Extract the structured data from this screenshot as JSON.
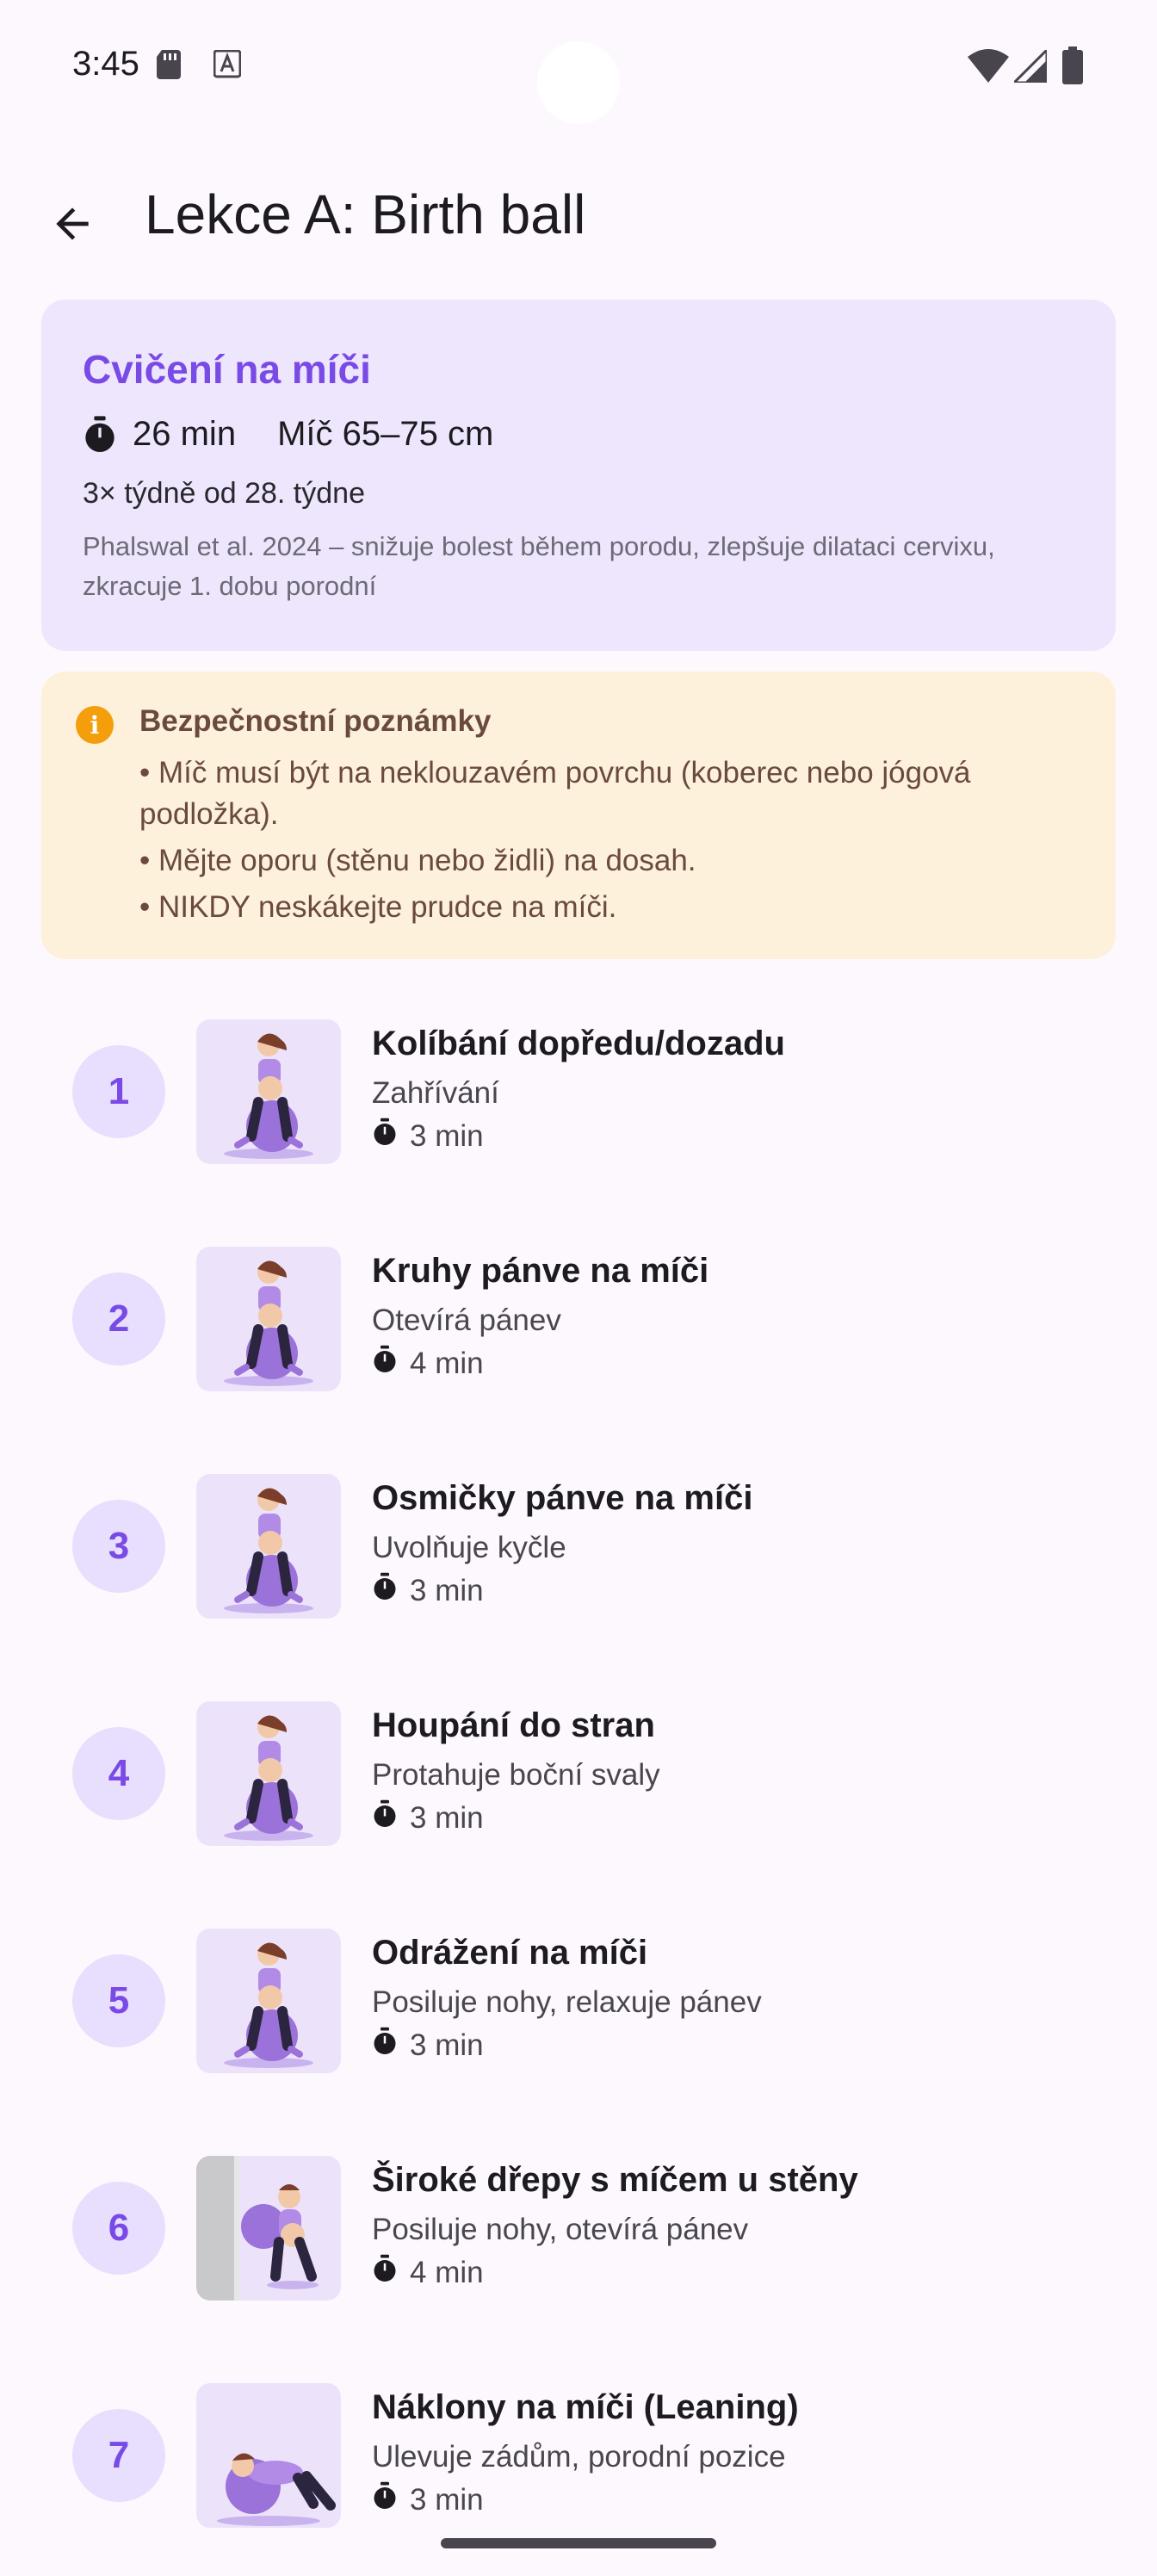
{
  "status_bar": {
    "time": "3:45"
  },
  "app_bar": {
    "title": "Lekce A: Birth ball"
  },
  "summary": {
    "heading": "Cvičení na míči",
    "duration": "26 min",
    "ball_size": "Míč 65–75 cm",
    "frequency": "3× týdně od 28. týdne",
    "source": "Phalswal et al. 2024 – snižuje bolest během porodu, zlepšuje dilataci cervixu, zkracuje 1. dobu porodní"
  },
  "safety": {
    "heading": "Bezpečnostní poznámky",
    "lines": [
      "• Míč musí být na neklouzavém povrchu (koberec nebo jógová podložka).",
      "• Mějte oporu (stěnu nebo židli) na dosah.",
      "• NIKDY neskákejte prudce na míči."
    ]
  },
  "exercises": [
    {
      "number": "1",
      "name": "Kolíbání dopředu/dozadu",
      "desc": "Zahřívání",
      "duration": "3 min",
      "image_icon": "woman-on-ball-icon"
    },
    {
      "number": "2",
      "name": "Kruhy pánve na míči",
      "desc": "Otevírá pánev",
      "duration": "4 min",
      "image_icon": "woman-on-ball-icon"
    },
    {
      "number": "3",
      "name": "Osmičky pánve na míči",
      "desc": "Uvolňuje kyčle",
      "duration": "3 min",
      "image_icon": "woman-on-ball-icon"
    },
    {
      "number": "4",
      "name": "Houpání do stran",
      "desc": "Protahuje boční svaly",
      "duration": "3 min",
      "image_icon": "woman-on-ball-icon"
    },
    {
      "number": "5",
      "name": "Odrážení na míči",
      "desc": "Posiluje nohy, relaxuje pánev",
      "duration": "3 min",
      "image_icon": "woman-on-ball-icon"
    },
    {
      "number": "6",
      "name": "Široké dřepy s míčem u stěny",
      "desc": "Posiluje nohy, otevírá pánev",
      "duration": "4 min",
      "image_icon": "wall-squat-icon"
    },
    {
      "number": "7",
      "name": "Náklony na míči (Leaning)",
      "desc": "Ulevuje zádům, porodní pozice",
      "duration": "3 min",
      "image_icon": "leaning-on-ball-icon"
    }
  ],
  "colors": {
    "accent": "#7a4ae6",
    "summary_bg": "#ede6fd",
    "safety_bg": "#fdf1dc",
    "warning": "#f59e0b",
    "background": "#fdf8fd"
  }
}
